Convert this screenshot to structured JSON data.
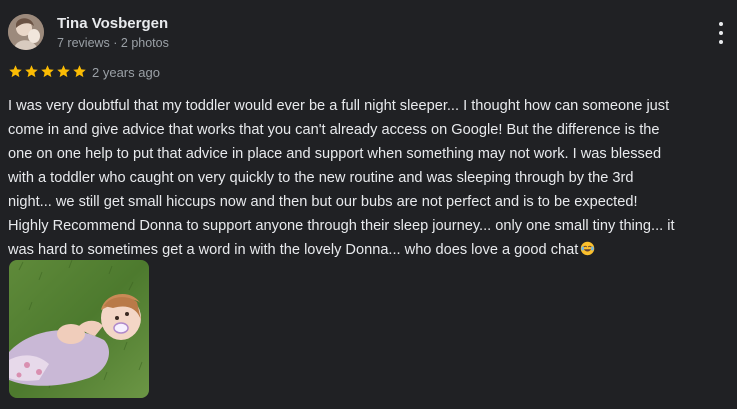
{
  "reviewer": {
    "name": "Tina Vosbergen",
    "meta": "7 reviews · 2 photos"
  },
  "rating": {
    "stars": 5,
    "max_stars": 5,
    "star_color": "#fbbc04",
    "date": "2 years ago"
  },
  "review": {
    "lines": [
      "I was very doubtful that my toddler would ever be a full night sleeper... I thought how can someone just",
      "come in and give advice that works that you can't already access on Google! But the difference is the",
      "one on one help to put that advice in place and support when something may not work. I was blessed",
      "with a toddler who caught on very quickly to the new routine and was sleeping through by the 3rd",
      "night... we still get small hiccups now and then but our bubs are not perfect and is to be expected!",
      "Highly Recommend Donna to support anyone through their sleep journey... only one small tiny thing... it",
      "was hard to sometimes get a word in with the lovely Donna... who does love a good chat"
    ],
    "trailing_emoji": "laughing-tears-emoji"
  },
  "icons": {
    "more": "more-vert-icon",
    "star": "star-icon"
  },
  "colors": {
    "background": "#202124",
    "text_primary": "#e8eaed",
    "text_secondary": "#9aa0a6"
  }
}
